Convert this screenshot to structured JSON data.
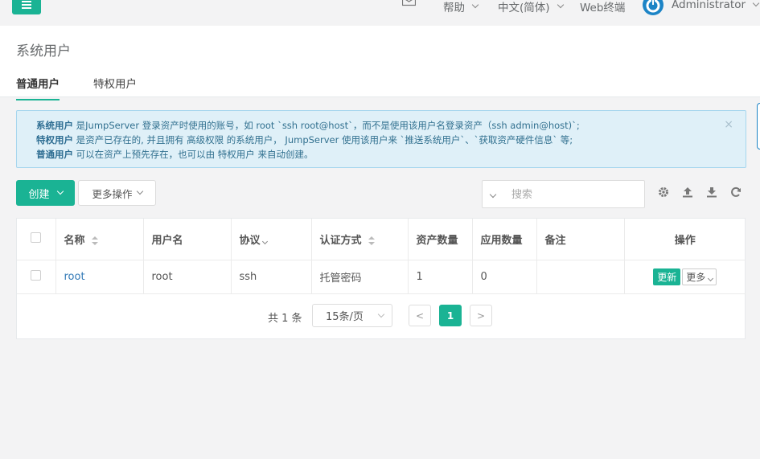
{
  "topbar": {
    "help": "帮助",
    "language": "中文(简体)",
    "web_terminal": "Web终端",
    "user": "Administrator"
  },
  "header": {
    "title": "系统用户",
    "tabs": [
      {
        "label": "普通用户",
        "active": true
      },
      {
        "label": "特权用户",
        "active": false
      }
    ]
  },
  "alert": {
    "lines": [
      {
        "strong": "系统用户",
        "text": " 是JumpServer 登录资产时使用的账号，如 root `ssh root@host`，而不是使用该用户名登录资产（ssh admin@host)`;"
      },
      {
        "strong": "特权用户",
        "text": " 是资产已存在的, 并且拥有 高级权限 的系统用户， JumpServer 使用该用户来 `推送系统用户`、`获取资产硬件信息` 等;"
      },
      {
        "strong": "普通用户",
        "text": " 可以在资产上预先存在，也可以由 特权用户 来自动创建。"
      }
    ],
    "close": "×"
  },
  "toolbar": {
    "create": "创建",
    "more_actions": "更多操作",
    "search_placeholder": "搜索"
  },
  "table": {
    "headers": [
      "名称",
      "用户名",
      "协议",
      "认证方式",
      "资产数量",
      "应用数量",
      "备注",
      "操作"
    ],
    "rows": [
      {
        "name": "root",
        "username": "root",
        "protocol": "ssh",
        "auth": "托管密码",
        "assets": "1",
        "apps": "0",
        "comment": "",
        "update": "更新",
        "more": "更多"
      }
    ]
  },
  "pagination": {
    "total": "共 1 条",
    "page_size": "15条/页",
    "prev": "<",
    "current": "1",
    "next": ">"
  },
  "colors": {
    "accent": "#1ab394",
    "link": "#337ab7",
    "alert_bg": "#dff0f8"
  }
}
